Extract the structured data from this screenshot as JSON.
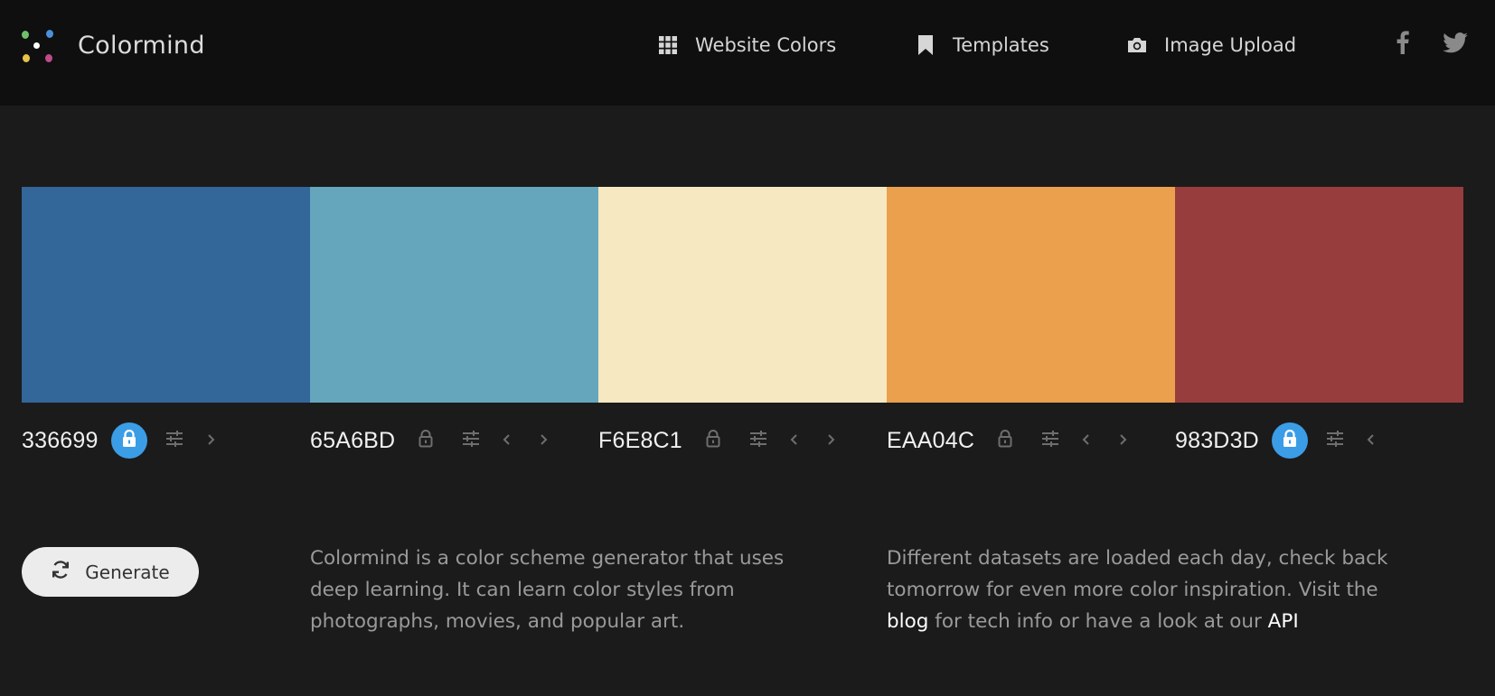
{
  "header": {
    "brand": "Colormind",
    "nav": [
      {
        "label": "Website Colors",
        "icon": "grid-icon"
      },
      {
        "label": "Templates",
        "icon": "bookmark-icon"
      },
      {
        "label": "Image Upload",
        "icon": "camera-icon"
      }
    ],
    "social": [
      {
        "icon": "facebook-icon"
      },
      {
        "icon": "twitter-icon"
      }
    ]
  },
  "palette": [
    {
      "hex": "336699",
      "color": "#336699",
      "locked": true
    },
    {
      "hex": "65A6BD",
      "color": "#65A6BD",
      "locked": false
    },
    {
      "hex": "F6E8C1",
      "color": "#F6E8C1",
      "locked": false
    },
    {
      "hex": "EAA04C",
      "color": "#EAA04C",
      "locked": false
    },
    {
      "hex": "983D3D",
      "color": "#983D3D",
      "locked": true
    }
  ],
  "generate": {
    "label": "Generate",
    "icon": "refresh-icon"
  },
  "description_left": "Colormind is a color scheme generator that uses deep learning. It can learn color styles from photographs, movies, and popular art.",
  "description_right": {
    "text_before": "Different datasets are loaded each day, check back tomorrow for even more color inspiration. Visit the",
    "link_blog": "blog",
    "text_middle": "for tech info or have a look at our",
    "link_api": "API"
  },
  "colors": {
    "accent": "#3b9de6",
    "header_bg": "#0f0f0f",
    "page_bg": "#1b1b1b"
  }
}
